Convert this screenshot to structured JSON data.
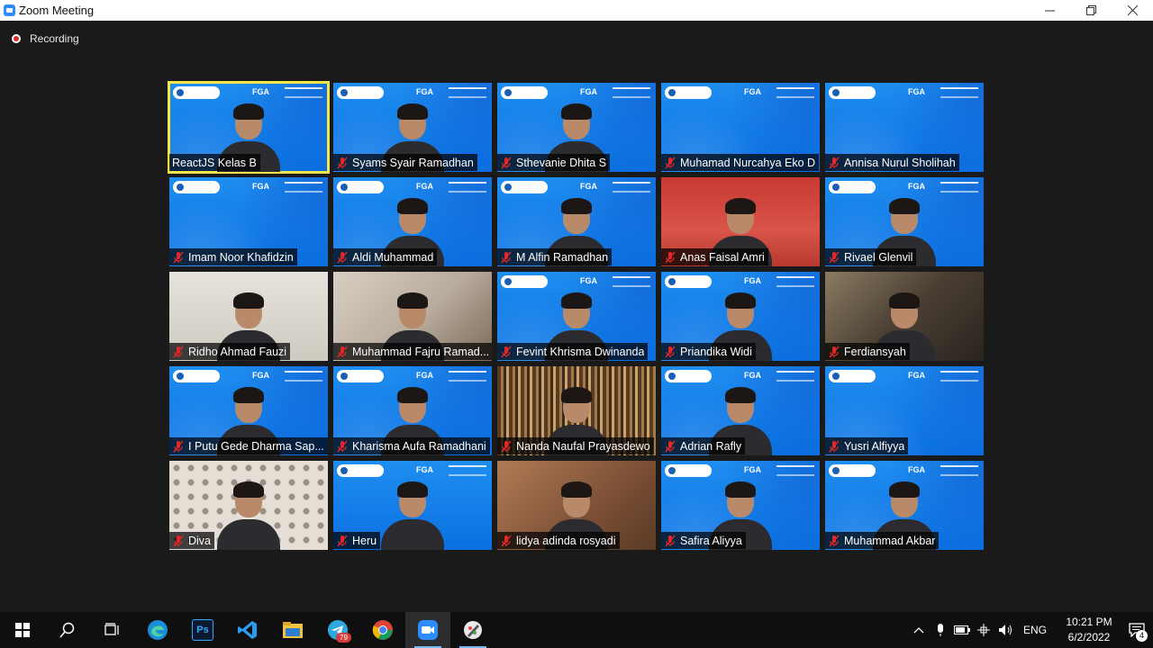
{
  "window": {
    "title": "Zoom Meeting",
    "icon": "zoom-app-icon",
    "controls": [
      "minimize-icon",
      "restore-icon",
      "close-icon"
    ]
  },
  "meeting": {
    "recording_label": "Recording",
    "banner_text": "FGA",
    "participants": [
      {
        "name": "ReactJS Kelas B",
        "muted": false,
        "bg": "blue",
        "speaker": true
      },
      {
        "name": "Syams Syair Ramadhan",
        "muted": true,
        "bg": "blue"
      },
      {
        "name": "Sthevanie Dhita S",
        "muted": true,
        "bg": "blue"
      },
      {
        "name": "Muhamad Nurcahya Eko D",
        "muted": true,
        "bg": "blue",
        "empty": true
      },
      {
        "name": "Annisa Nurul Sholihah",
        "muted": true,
        "bg": "blue",
        "empty": true
      },
      {
        "name": "Imam Noor Khafidzin",
        "muted": true,
        "bg": "blue",
        "empty": true
      },
      {
        "name": "Aldi Muhammad",
        "muted": true,
        "bg": "blue"
      },
      {
        "name": "M Alfin Ramadhan",
        "muted": true,
        "bg": "blue"
      },
      {
        "name": "Anas Faisal Amri",
        "muted": true,
        "bg": "red"
      },
      {
        "name": "Rivael Glenvil",
        "muted": true,
        "bg": "blue"
      },
      {
        "name": "Ridho Ahmad Fauzi",
        "muted": true,
        "bg": "cream"
      },
      {
        "name": "Muhammad Fajru Ramad...",
        "muted": true,
        "bg": "room"
      },
      {
        "name": "Fevint Khrisma Dwinanda",
        "muted": true,
        "bg": "blue"
      },
      {
        "name": "Priandika Widi",
        "muted": true,
        "bg": "blue"
      },
      {
        "name": "Ferdiansyah",
        "muted": true,
        "bg": "dark"
      },
      {
        "name": "I Putu Gede Dharma Sap...",
        "muted": true,
        "bg": "blue"
      },
      {
        "name": "Kharisma Aufa Ramadhani",
        "muted": true,
        "bg": "blue"
      },
      {
        "name": "Nanda Naufal Prayasdewo",
        "muted": true,
        "bg": "books"
      },
      {
        "name": "Adrian Rafly",
        "muted": true,
        "bg": "blue"
      },
      {
        "name": "Yusri Alfiyya",
        "muted": true,
        "bg": "blue",
        "empty": true
      },
      {
        "name": "Diva",
        "muted": true,
        "bg": "pattern"
      },
      {
        "name": "Heru",
        "muted": true,
        "bg": "blue2"
      },
      {
        "name": "lidya adinda rosyadi",
        "muted": true,
        "bg": "wall"
      },
      {
        "name": "Safira Aliyya",
        "muted": true,
        "bg": "blue"
      },
      {
        "name": "Muhammad Akbar",
        "muted": true,
        "bg": "blue"
      }
    ]
  },
  "taskbar": {
    "apps": [
      {
        "icon": "windows-start-icon"
      },
      {
        "icon": "search-icon"
      },
      {
        "icon": "task-view-icon"
      },
      {
        "icon": "edge-icon"
      },
      {
        "icon": "photoshop-icon",
        "label": "Ps"
      },
      {
        "icon": "vscode-icon"
      },
      {
        "icon": "file-explorer-icon"
      },
      {
        "icon": "telegram-icon",
        "badge": "79"
      },
      {
        "icon": "chrome-icon"
      },
      {
        "icon": "zoom-icon",
        "active": true
      },
      {
        "icon": "pen-app-icon"
      }
    ],
    "tray": {
      "language": "ENG",
      "time": "10:21 PM",
      "date": "6/2/2022",
      "notifications": "4"
    }
  }
}
